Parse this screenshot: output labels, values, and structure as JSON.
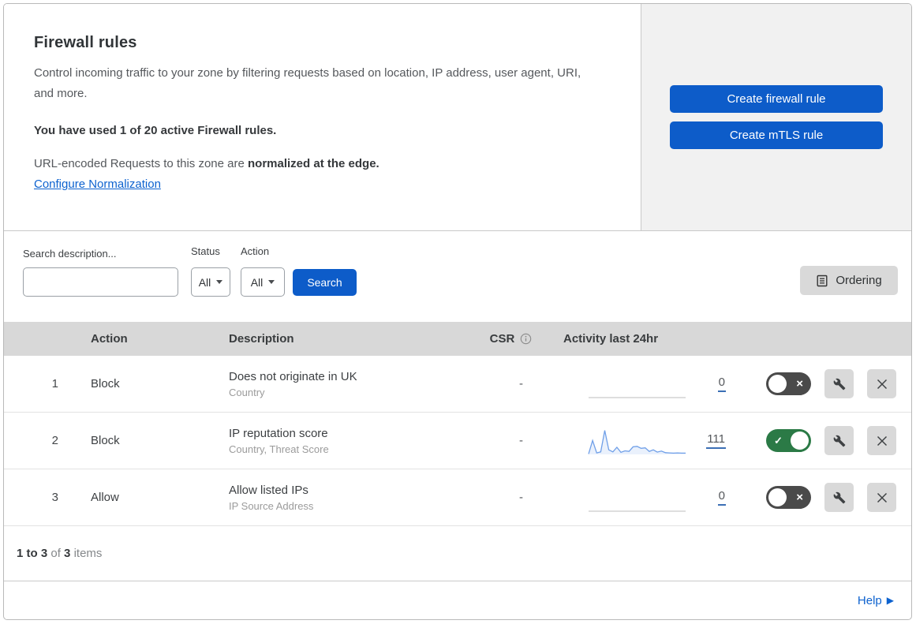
{
  "colors": {
    "accent_blue": "#0d5cc9",
    "link_blue": "#0d62cf",
    "toggle_on_green": "#2b7a46",
    "toggle_off_grey": "#4a4a4a",
    "table_header_grey": "#d8d8d8",
    "side_panel_grey": "#f1f1f1",
    "sparkline_blue": "#6f9fe8"
  },
  "header": {
    "title": "Firewall rules",
    "description": "Control incoming traffic to your zone by filtering requests based on location, IP address, user agent, URI, and more.",
    "usage_line": "You have used 1 of 20 active Firewall rules.",
    "normalization_prefix": "URL-encoded Requests to this zone are ",
    "normalization_bold": "normalized at the edge.",
    "normalization_link": "Configure Normalization",
    "create_firewall_button": "Create firewall rule",
    "create_mtls_button": "Create mTLS rule"
  },
  "filters": {
    "search_label": "Search description...",
    "status_label": "Status",
    "status_value": "All",
    "action_label": "Action",
    "action_value": "All",
    "search_button": "Search",
    "ordering_button": "Ordering"
  },
  "table": {
    "headers": {
      "action": "Action",
      "description": "Description",
      "csr": "CSR",
      "activity": "Activity last 24hr"
    },
    "rows": [
      {
        "num": "1",
        "action": "Block",
        "description": "Does not originate in UK",
        "criteria": "Country",
        "csr": "-",
        "count": "0",
        "enabled": false,
        "sparkline": null
      },
      {
        "num": "2",
        "action": "Block",
        "description": "IP reputation score",
        "criteria": "Country, Threat Score",
        "csr": "-",
        "count": "111",
        "enabled": true,
        "sparkline": [
          2,
          55,
          6,
          10,
          95,
          18,
          10,
          28,
          8,
          14,
          12,
          30,
          32,
          24,
          26,
          12,
          18,
          9,
          13,
          7,
          6,
          5,
          6,
          5,
          5
        ]
      },
      {
        "num": "3",
        "action": "Allow",
        "description": "Allow listed IPs",
        "criteria": "IP Source Address",
        "csr": "-",
        "count": "0",
        "enabled": false,
        "sparkline": null
      }
    ]
  },
  "footer": {
    "range": "1 to 3",
    "of": "of",
    "total": "3",
    "items": "items"
  },
  "help": {
    "label": "Help"
  }
}
